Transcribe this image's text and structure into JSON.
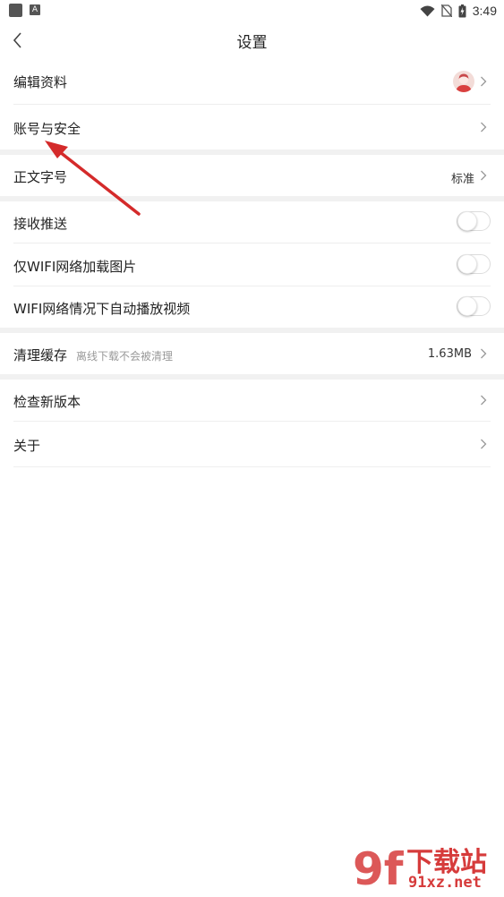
{
  "status_bar": {
    "time": "3:49"
  },
  "header": {
    "title": "设置"
  },
  "rows": {
    "edit_profile": {
      "label": "编辑资料"
    },
    "account_security": {
      "label": "账号与安全"
    },
    "font_size": {
      "label": "正文字号",
      "value": "标准"
    },
    "push": {
      "label": "接收推送",
      "enabled": false
    },
    "wifi_images": {
      "label": "仅WIFI网络加载图片",
      "enabled": false
    },
    "wifi_autoplay": {
      "label": "WIFI网络情况下自动播放视频",
      "enabled": false
    },
    "clear_cache": {
      "label": "清理缓存",
      "hint": "离线下载不会被清理",
      "value": "1.63MB"
    },
    "check_update": {
      "label": "检查新版本"
    },
    "about": {
      "label": "关于"
    }
  },
  "watermark": {
    "logo_text": "9f",
    "title": "下载站",
    "domain": "91xz.net"
  },
  "colors": {
    "annotation_arrow": "#d42a2a",
    "divider_band": "#f1f1f1",
    "watermark": "#d63b3b"
  }
}
